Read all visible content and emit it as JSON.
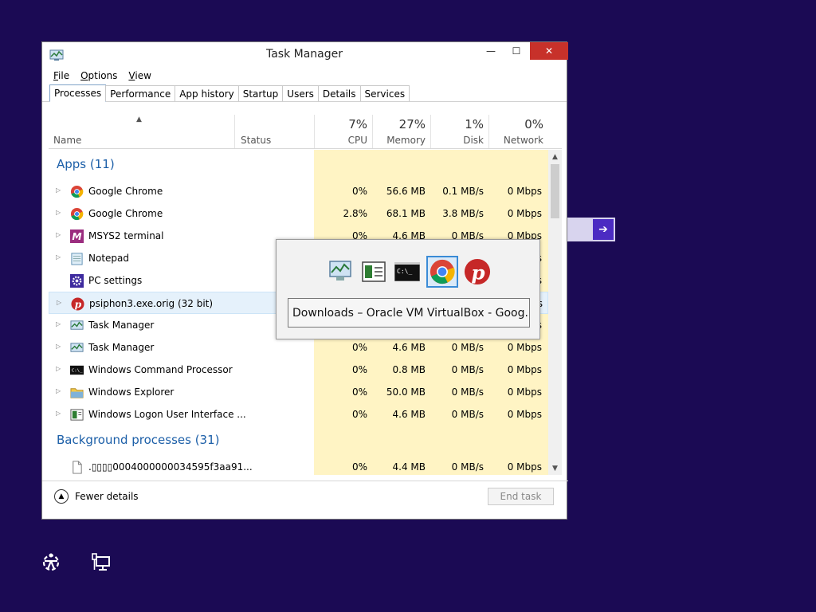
{
  "window": {
    "title": "Task Manager",
    "controls": {
      "minimize": "—",
      "maximize": "☐",
      "close": "✕"
    }
  },
  "menu": [
    {
      "key": "F",
      "rest": "ile"
    },
    {
      "key": "O",
      "rest": "ptions"
    },
    {
      "key": "V",
      "rest": "iew"
    }
  ],
  "tabs": [
    "Processes",
    "Performance",
    "App history",
    "Startup",
    "Users",
    "Details",
    "Services"
  ],
  "columns": {
    "name": "Name",
    "status": "Status",
    "cpu": {
      "pct": "7%",
      "label": "CPU"
    },
    "memory": {
      "pct": "27%",
      "label": "Memory"
    },
    "disk": {
      "pct": "1%",
      "label": "Disk"
    },
    "network": {
      "pct": "0%",
      "label": "Network"
    }
  },
  "groups": {
    "apps": "Apps (11)",
    "background": "Background processes (31)"
  },
  "rows": [
    {
      "name": "Google Chrome",
      "icon": "chrome-icon",
      "cpu": "0%",
      "mem": "56.6 MB",
      "disk": "0.1 MB/s",
      "net": "0 Mbps"
    },
    {
      "name": "Google Chrome",
      "icon": "chrome-icon",
      "cpu": "2.8%",
      "mem": "68.1 MB",
      "disk": "3.8 MB/s",
      "net": "0 Mbps"
    },
    {
      "name": "MSYS2 terminal",
      "icon": "msys2-icon",
      "cpu": "0%",
      "mem": "4.6 MB",
      "disk": "0 MB/s",
      "net": "0 Mbps"
    },
    {
      "name": "Notepad",
      "icon": "notepad-icon",
      "cpu": "",
      "mem": "",
      "disk": "",
      "net": "ps"
    },
    {
      "name": "PC settings",
      "icon": "gear-icon",
      "cpu": "",
      "mem": "",
      "disk": "",
      "net": "ps"
    },
    {
      "name": "psiphon3.exe.orig (32 bit)",
      "icon": "psiphon-icon",
      "cpu": "",
      "mem": "",
      "disk": "",
      "net": "ps"
    },
    {
      "name": "Task Manager",
      "icon": "taskmanager-icon",
      "cpu": "",
      "mem": "",
      "disk": "",
      "net": "ps"
    },
    {
      "name": "Task Manager",
      "icon": "taskmanager-icon",
      "cpu": "0%",
      "mem": "4.6 MB",
      "disk": "0 MB/s",
      "net": "0 Mbps"
    },
    {
      "name": "Windows Command Processor",
      "icon": "cmd-icon",
      "cpu": "0%",
      "mem": "0.8 MB",
      "disk": "0 MB/s",
      "net": "0 Mbps"
    },
    {
      "name": "Windows Explorer",
      "icon": "folder-icon",
      "cpu": "0%",
      "mem": "50.0 MB",
      "disk": "0 MB/s",
      "net": "0 Mbps"
    },
    {
      "name": "Windows Logon User Interface ...",
      "icon": "logon-icon",
      "cpu": "0%",
      "mem": "4.6 MB",
      "disk": "0 MB/s",
      "net": "0 Mbps"
    },
    {
      "name": ".▯▯▯▯0004000000034595f3aa91...",
      "icon": "file-icon",
      "cpu": "0%",
      "mem": "4.4 MB",
      "disk": "0 MB/s",
      "net": "0 Mbps"
    }
  ],
  "footer": {
    "fewer_details": "Fewer details",
    "end_task": "End task"
  },
  "switcher": {
    "caption": "Downloads – Oracle VM VirtualBox - Goog..."
  },
  "colors": {
    "desktop": "#1b0a54",
    "accent": "#1c5fa8",
    "close": "#c7312a",
    "highlight": "#fff4c4"
  }
}
